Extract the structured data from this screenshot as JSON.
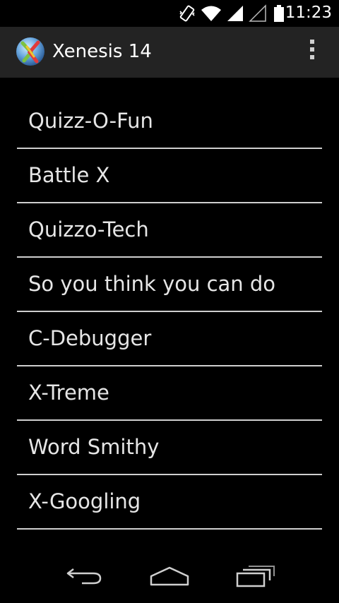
{
  "status_bar": {
    "time": "11:23",
    "icons": [
      "vibrate-icon",
      "wifi-icon",
      "signal-icon",
      "signal-empty-icon",
      "battery-icon"
    ]
  },
  "action_bar": {
    "title": "Xenesis 14",
    "app_icon": "xenesis-logo-icon",
    "overflow_icon": "overflow-menu-icon"
  },
  "menu": {
    "items": [
      {
        "label": "Quizz-O-Fun"
      },
      {
        "label": "Battle X"
      },
      {
        "label": "Quizzo-Tech"
      },
      {
        "label": "So you think you can do"
      },
      {
        "label": "C-Debugger"
      },
      {
        "label": "X-Treme"
      },
      {
        "label": "Word Smithy"
      },
      {
        "label": "X-Googling"
      }
    ]
  },
  "nav_bar": {
    "icons": [
      "back-icon",
      "home-icon",
      "recents-icon"
    ]
  },
  "colors": {
    "background": "#000000",
    "action_bar": "#232323",
    "divider": "#cfcfcf",
    "text": "#e6e6e6"
  }
}
